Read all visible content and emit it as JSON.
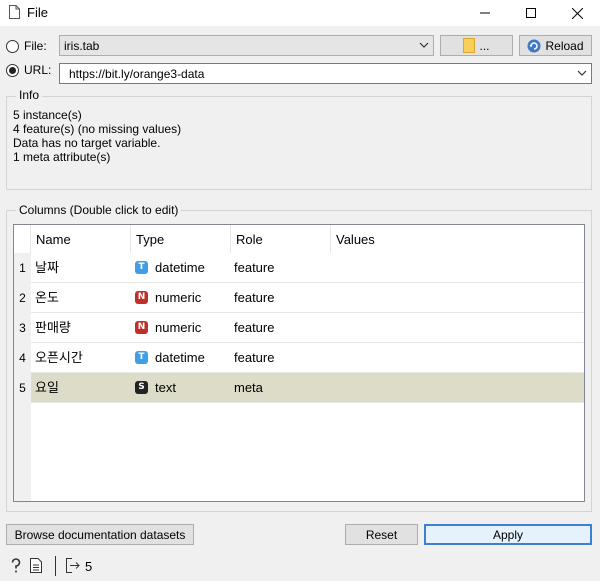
{
  "window": {
    "title": "File",
    "app_icon": "document-icon"
  },
  "source": {
    "file_label": "File:",
    "file_value": "iris.tab",
    "browse_label": "...",
    "reload_label": "Reload",
    "url_label": "URL:",
    "url_value": "https://bit.ly/orange3-data",
    "selected": "url"
  },
  "info": {
    "title": "Info",
    "lines": [
      "5 instance(s)",
      "4 feature(s) (no missing values)",
      "Data has no target variable.",
      "1 meta attribute(s)"
    ]
  },
  "columns": {
    "title": "Columns (Double click to edit)",
    "headers": [
      "Name",
      "Type",
      "Role",
      "Values"
    ],
    "rows": [
      {
        "num": "1",
        "name": "날짜",
        "type_icon": "T",
        "type": "datetime",
        "role": "feature",
        "values": ""
      },
      {
        "num": "2",
        "name": "온도",
        "type_icon": "N",
        "type": "numeric",
        "role": "feature",
        "values": ""
      },
      {
        "num": "3",
        "name": "판매량",
        "type_icon": "N",
        "type": "numeric",
        "role": "feature",
        "values": ""
      },
      {
        "num": "4",
        "name": "오픈시간",
        "type_icon": "T",
        "type": "datetime",
        "role": "feature",
        "values": ""
      },
      {
        "num": "5",
        "name": "요일",
        "type_icon": "S",
        "type": "text",
        "role": "meta",
        "values": ""
      }
    ],
    "selected_row": 5
  },
  "buttons": {
    "browse_docs": "Browse documentation datasets",
    "reset": "Reset",
    "apply": "Apply"
  },
  "status": {
    "output_count": "5"
  },
  "colors": {
    "datetime": "#3f9ee5",
    "numeric": "#c0302b",
    "text": "#222222",
    "selected_row": "#dcdcc8",
    "apply_border": "#3c7fd6"
  }
}
